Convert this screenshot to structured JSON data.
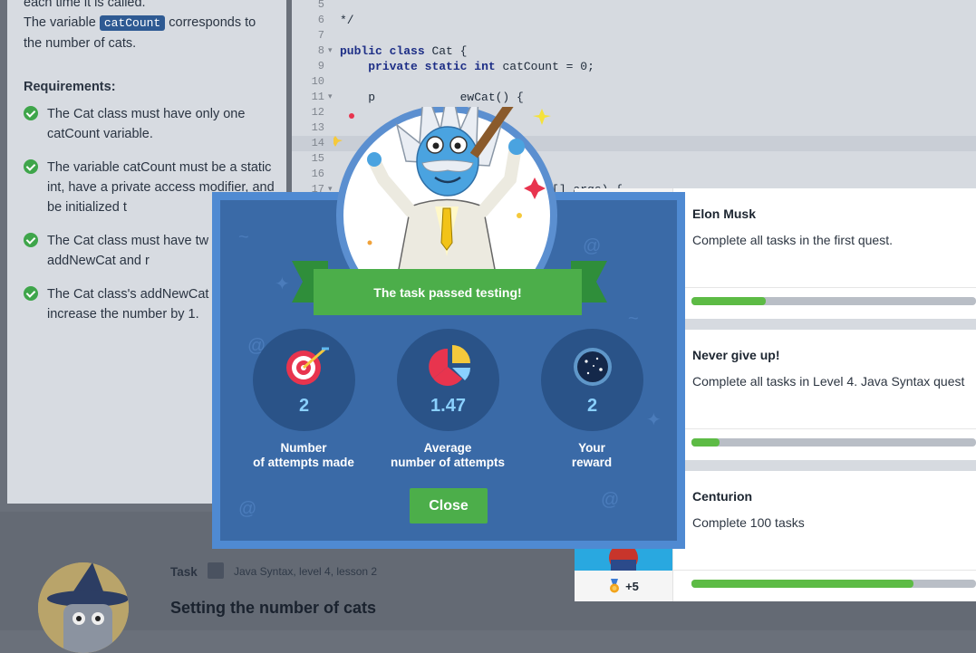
{
  "instructions": {
    "line1": "each time it is called.",
    "line2_pre": "The variable ",
    "line2_code": "catCount",
    "line2_post": " corresponds to",
    "line3": "the number of cats.",
    "requirements_title": "Requirements:",
    "requirements": [
      "The Cat class must have only one catCount variable.",
      "The variable catCount must be a static int, have a private access modifier, and be initialized t",
      "The Cat class must have tw methods: addNewCat and r",
      "The Cat class's addNewCat should increase the number by 1."
    ]
  },
  "editor": {
    "lines": [
      {
        "n": "5",
        "code": ""
      },
      {
        "n": "6",
        "code": "*/"
      },
      {
        "n": "7",
        "code": ""
      },
      {
        "n": "8",
        "code": "public class Cat {",
        "fold": true
      },
      {
        "n": "9",
        "code": "    private static int catCount = 0;"
      },
      {
        "n": "10",
        "code": ""
      },
      {
        "n": "11",
        "code": "    p            ewCat() {",
        "fold": true
      },
      {
        "n": "12",
        "code": "               her"
      },
      {
        "n": "13",
        "code": ""
      },
      {
        "n": "14",
        "code": ""
      },
      {
        "n": "15",
        "code": ""
      },
      {
        "n": "16",
        "code": ""
      },
      {
        "n": "17",
        "code": "                           ing[] args) {",
        "fold": true
      }
    ]
  },
  "task": {
    "label": "Task",
    "meta": "Java Syntax,  level 4,  lesson 2",
    "title": "Setting the number of cats"
  },
  "modal": {
    "banner": "The task passed testing!",
    "stats": [
      {
        "value": "2",
        "label": "Number\nof attempts made",
        "icon": "target-icon"
      },
      {
        "value": "1.47",
        "label": "Average\nnumber of attempts",
        "icon": "pie-chart-icon"
      },
      {
        "value": "2",
        "label": "Your\nreward",
        "icon": "dark-matter-icon"
      }
    ],
    "close_label": "Close"
  },
  "achievements": [
    {
      "name": "Elon Musk",
      "desc": "Complete all tasks in the first quest.",
      "progress": 0.26
    },
    {
      "name": "Never give up!",
      "desc": "Complete all tasks in Level 4. Java Syntax quest",
      "progress": 0.1
    },
    {
      "name": "Centurion",
      "desc": "Complete 100 tasks",
      "progress": 0.78,
      "reward": "+5"
    }
  ],
  "colors": {
    "accent_green": "#4cae4a",
    "modal_blue": "#3a6aa7",
    "frame_blue": "#4f8ad2",
    "stat_value": "#8ad0ff"
  }
}
